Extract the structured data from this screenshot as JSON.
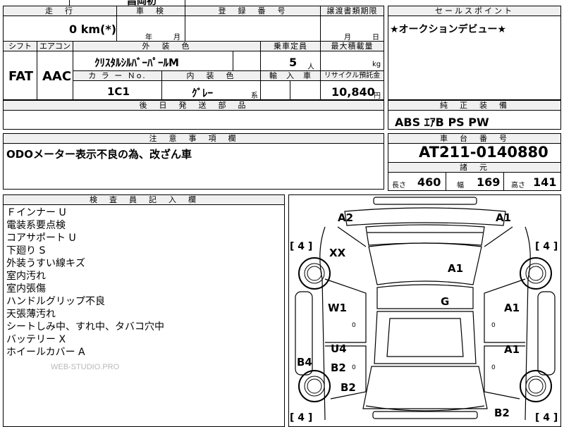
{
  "top_partial": {
    "text": "昌岡初"
  },
  "mileage": {
    "header": "走　行",
    "value": "0 km(*)"
  },
  "inspection": {
    "header": "車　検",
    "year_unit": "年",
    "month_unit": "月"
  },
  "registration": {
    "header": "登　録　番　号",
    "value": ""
  },
  "transfer_deadline": {
    "header": "譲渡書類期限",
    "month_unit": "月",
    "day_unit": "日"
  },
  "sales_point": {
    "header": "セールスポイント",
    "text": "★オークションデビュー★"
  },
  "shift": {
    "header": "シフト",
    "value": "FAT"
  },
  "aircon": {
    "header": "エアコン",
    "value": "AAC"
  },
  "exterior_color": {
    "header": "外　装　色",
    "value": "ｸﾘｽﾀﾙｼﾙﾊﾞｰﾊﾟｰﾙM"
  },
  "capacity": {
    "header": "乗車定員",
    "value": "5",
    "unit": "人"
  },
  "max_load": {
    "header": "最大積載量",
    "unit": "kg"
  },
  "color_no": {
    "header": "カ ラ ー Ｎo.",
    "value": "1C1"
  },
  "interior_color": {
    "header": "内　装　色",
    "value": "ｸﾞﾚｰ",
    "suffix": "系"
  },
  "import": {
    "header": "輸　入　車"
  },
  "recycle": {
    "header": "リサイクル預託金",
    "value": "10,840",
    "unit": "円"
  },
  "later_parts": {
    "header": "後　日　発　送　部　品",
    "value": ""
  },
  "equipment": {
    "header": "純　正　装　備",
    "value": "ABS ｴｱB PS PW"
  },
  "notice": {
    "header": "注　意　事　項　欄",
    "text": "ODOメーター表示不良の為、改ざん車"
  },
  "chassis": {
    "header": "車　台　番　号",
    "value": "AT211-0140880"
  },
  "specs": {
    "header": "諸　元",
    "length_label": "長さ",
    "length": "460",
    "width_label": "幅",
    "width": "169",
    "height_label": "高さ",
    "height": "141"
  },
  "inspector": {
    "header": "検　査　員　記　入　欄",
    "notes": [
      "Ｆインナー U",
      "電装系要点検",
      "コアサポート U",
      "下廻り S",
      "外装うすい線キズ",
      "室内汚れ",
      "室内張傷",
      "ハンドルグリップ不良",
      "天張薄汚れ",
      "シートしみ中、すれ中、タバコ穴中",
      "バッテリー X",
      "ホイールカバー A"
    ]
  },
  "watermark": "WEB-STUDIO.PRO",
  "diagram": {
    "marks": [
      "A2",
      "A1",
      "XX",
      "A1",
      "W1",
      "G",
      "A1",
      "U4",
      "A1",
      "B4",
      "B2",
      "B2",
      "B2"
    ],
    "tires": [
      "[ 4 ]",
      "[ 4 ]",
      "[ 4 ]",
      "[ 4 ]"
    ],
    "small_zero": "0"
  }
}
